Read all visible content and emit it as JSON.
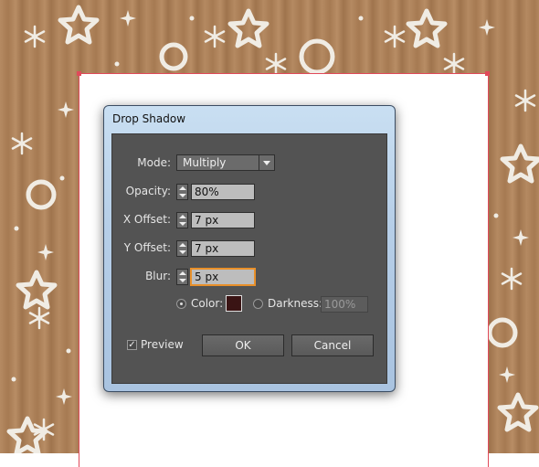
{
  "dialog": {
    "title": "Drop Shadow",
    "mode": {
      "label": "Mode:",
      "value": "Multiply"
    },
    "opacity": {
      "label": "Opacity:",
      "value": "80%"
    },
    "x_offset": {
      "label": "X Offset:",
      "value": "7 px"
    },
    "y_offset": {
      "label": "Y Offset:",
      "value": "7 px"
    },
    "blur": {
      "label": "Blur:",
      "value": "5 px"
    },
    "color": {
      "label": "Color:",
      "selected": true,
      "swatch": "#3a1414"
    },
    "darkness": {
      "label": "Darkness:",
      "value": "100%",
      "selected": false
    },
    "preview": {
      "label": "Preview",
      "checked": true
    },
    "ok_label": "OK",
    "cancel_label": "Cancel"
  },
  "colors": {
    "background_brown": "#a67a52",
    "selection_red": "#e04a5a",
    "panel_gray": "#535353",
    "focus_orange": "#e8902a"
  }
}
